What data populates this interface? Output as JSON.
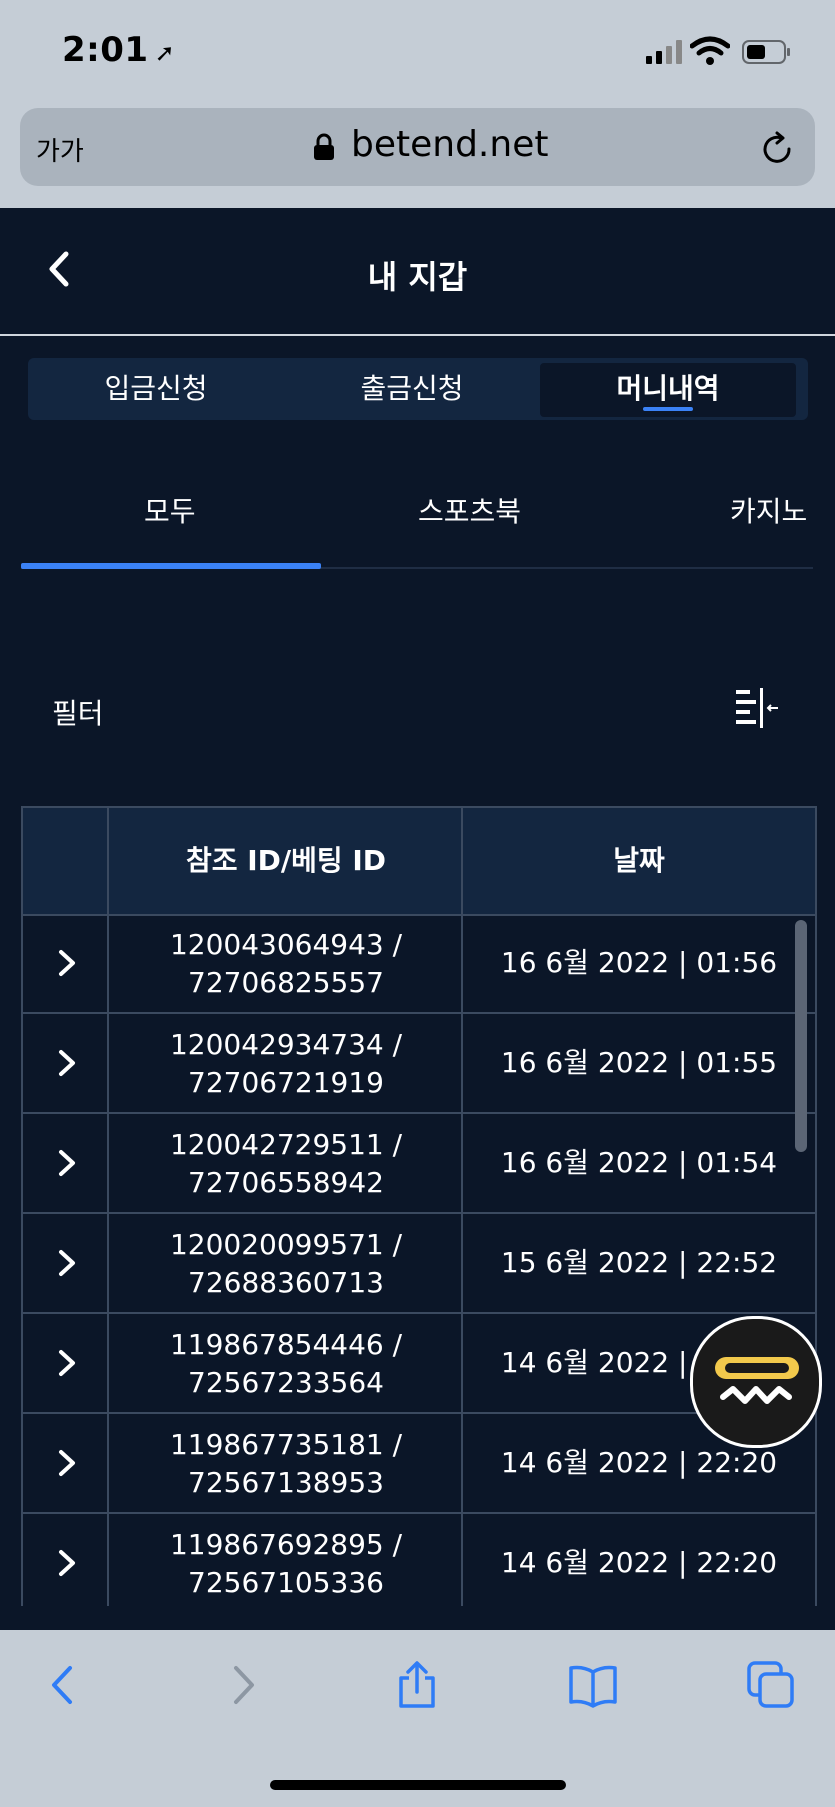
{
  "status_bar": {
    "time": "2:01"
  },
  "browser": {
    "text_size_label": "가가",
    "url": "betend.net"
  },
  "header": {
    "title": "내 지갑"
  },
  "main_tabs": [
    {
      "label": "입금신청",
      "active": false
    },
    {
      "label": "출금신청",
      "active": false
    },
    {
      "label": "머니내역",
      "active": true
    }
  ],
  "sub_tabs": [
    {
      "label": "모두",
      "active": true
    },
    {
      "label": "스포츠북",
      "active": false
    },
    {
      "label": "카지노",
      "active": false
    }
  ],
  "filter": {
    "label": "필터"
  },
  "table": {
    "headers": [
      "참조 ID/베팅 ID",
      "날짜"
    ],
    "rows": [
      {
        "ref_id": "120043064943 /",
        "bet_id": "72706825557",
        "date": "16 6월 2022 | 01:56"
      },
      {
        "ref_id": "120042934734 /",
        "bet_id": "72706721919",
        "date": "16 6월 2022 | 01:55"
      },
      {
        "ref_id": "120042729511 /",
        "bet_id": "72706558942",
        "date": "16 6월 2022 | 01:54"
      },
      {
        "ref_id": "120020099571 /",
        "bet_id": "72688360713",
        "date": "15 6월 2022 | 22:52"
      },
      {
        "ref_id": "119867854446 /",
        "bet_id": "72567233564",
        "date": "14 6월 2022 | 22:21"
      },
      {
        "ref_id": "119867735181 /",
        "bet_id": "72567138953",
        "date": "14 6월 2022 | 22:20"
      },
      {
        "ref_id": "119867692895 /",
        "bet_id": "72567105336",
        "date": "14 6월 2022 | 22:20"
      }
    ]
  },
  "colors": {
    "background": "#0b1628",
    "accent": "#3b82f6",
    "tab_bar": "#132640",
    "chrome": "#c5cdd6"
  },
  "icons": [
    "location-arrow-icon",
    "signal-icon",
    "wifi-icon",
    "battery-icon",
    "lock-icon",
    "reload-icon",
    "back-chevron-icon",
    "filter-icon",
    "row-chevron-icon",
    "chat-fab-icon",
    "nav-back-icon",
    "nav-forward-icon",
    "share-icon",
    "bookmarks-icon",
    "tabs-icon"
  ]
}
